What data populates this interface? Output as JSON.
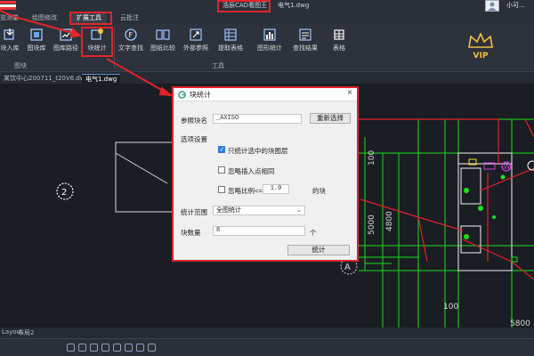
{
  "titlebar": {
    "app_title": "浩辰CAD看图王",
    "file_title": "电气1.dwg",
    "username": "小可..."
  },
  "menu": {
    "tabs": [
      "览测量",
      "绘图修改",
      "扩展工具",
      "云批注"
    ],
    "active": "扩展工具"
  },
  "ribbon": {
    "tools_block": [
      {
        "label": "块入库",
        "icon": "block-import-icon"
      },
      {
        "label": "图块库",
        "icon": "block-library-icon"
      },
      {
        "label": "图库路径",
        "icon": "library-path-icon"
      },
      {
        "label": "块统计",
        "icon": "block-stats-icon"
      }
    ],
    "tools_tool": [
      {
        "label": "文字查找",
        "icon": "text-search-icon"
      },
      {
        "label": "图纸比较",
        "icon": "drawing-compare-icon"
      },
      {
        "label": "外部参照",
        "icon": "xref-icon"
      },
      {
        "label": "提取表格",
        "icon": "extract-table-icon"
      },
      {
        "label": "图形统计",
        "icon": "shape-stats-icon"
      },
      {
        "label": "查找结果",
        "icon": "find-results-icon"
      },
      {
        "label": "表格",
        "icon": "table-icon"
      }
    ],
    "group_block": "图块",
    "group_tool": "工具",
    "vip": "VIP"
  },
  "doc_tabs": [
    "某饮中心200711_t20V6.dwg",
    "电气1.dwg"
  ],
  "layout_tabs": [
    "Layout",
    "布局2"
  ],
  "drawing": {
    "dim_5000": "5000",
    "dim_4800": "4800",
    "dim_100a": "100",
    "dim_100b": "100",
    "dim_5800": "5800",
    "grid_2": "2",
    "grid_a": "A"
  },
  "dialog": {
    "title": "块统计",
    "block_name_label": "参照块名",
    "block_name_value": "_AXISO",
    "reselect_button": "重新选择",
    "options_label": "选项设置",
    "opt1": "只统计选中的块图层",
    "opt1_checked": true,
    "opt2": "忽略插入点相同",
    "opt2_checked": false,
    "opt3_prefix": "忽略比例<=",
    "opt3_value": "1.0",
    "opt3_suffix": "的块",
    "opt3_checked": false,
    "scope_label": "统计范围",
    "scope_value": "全图统计",
    "count_label": "块数量",
    "count_value": "8",
    "count_unit": "个",
    "stats_button": "统计"
  },
  "colors": {
    "callout": "#e3242b",
    "accent_blue": "#2f7be0",
    "cad_green": "#18e018",
    "cad_red": "#e8202a"
  }
}
